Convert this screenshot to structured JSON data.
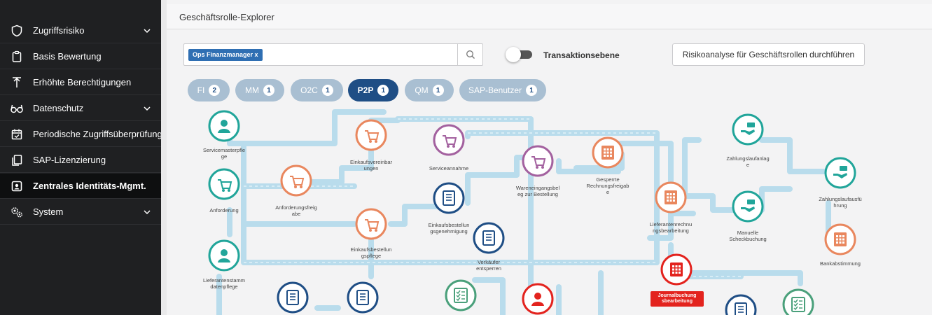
{
  "sidebar": {
    "items": [
      {
        "label": "Zugriffsrisiko",
        "icon": "shield-icon",
        "expandable": true
      },
      {
        "label": "Basis Bewertung",
        "icon": "clipboard-icon",
        "expandable": false
      },
      {
        "label": "Erhöhte Berechtigungen",
        "icon": "elevate-icon",
        "expandable": false
      },
      {
        "label": "Datenschutz",
        "icon": "glasses-icon",
        "expandable": true
      },
      {
        "label": "Periodische Zugriffsüberprüfung",
        "icon": "calendar-check-icon",
        "expandable": false
      },
      {
        "label": "SAP-Lizenzierung",
        "icon": "license-icon",
        "expandable": false
      },
      {
        "label": "Zentrales Identitäts-Mgmt.",
        "icon": "id-card-icon",
        "expandable": false,
        "active": true
      },
      {
        "label": "System",
        "icon": "gears-icon",
        "expandable": true
      }
    ]
  },
  "header": {
    "title": "Geschäftsrolle-Explorer"
  },
  "search": {
    "chip": "Ops Finanzmanager  x"
  },
  "toggle": {
    "label": "Transaktionsebene",
    "on": false
  },
  "risk_button": {
    "label": "Risikoanalyse für Geschäftsrollen durchführen"
  },
  "tabs": [
    {
      "label": "FI",
      "count": "2",
      "active": false
    },
    {
      "label": "MM",
      "count": "1",
      "active": false
    },
    {
      "label": "O2C",
      "count": "1",
      "active": false
    },
    {
      "label": "P2P",
      "count": "1",
      "active": true
    },
    {
      "label": "QM",
      "count": "1",
      "active": false
    },
    {
      "label": "SAP-Benutzer",
      "count": "1",
      "active": false
    }
  ],
  "colors": {
    "teal": "#21a59a",
    "orange": "#e9875e",
    "purple": "#a3619f",
    "navy": "#1f4e85",
    "green": "#4aa07b",
    "red": "#e3231e",
    "pipe": "#b9dcec"
  },
  "nodes": [
    {
      "id": "servicemasterpflege",
      "label": "Servicemasterpfle\nge",
      "color": "teal",
      "icon": "user-icon"
    },
    {
      "id": "anforderung",
      "label": "Anforderung",
      "color": "teal",
      "icon": "cart-icon"
    },
    {
      "id": "lieferantenstamm",
      "label": "Lieferantenstamm\ndatenpflege",
      "color": "teal",
      "icon": "user-icon"
    },
    {
      "id": "anforderungsfreigabe",
      "label": "Anforderungsfreig\nabe",
      "color": "orange",
      "icon": "cart-icon"
    },
    {
      "id": "einkaufsvereinbarungen",
      "label": "Einkaufsvereinbar\nungen",
      "color": "orange",
      "icon": "cart-icon"
    },
    {
      "id": "einkaufsbestellungspflege",
      "label": "Einkaufsbestellun\ngspflege",
      "color": "orange",
      "icon": "cart-icon"
    },
    {
      "id": "serviceannahme",
      "label": "Serviceannahme",
      "color": "purple",
      "icon": "trolley-icon"
    },
    {
      "id": "einkaufsbestellungsgenehmigung",
      "label": "Einkaufsbestellun\ngsgenehmigung",
      "color": "navy",
      "icon": "document-icon"
    },
    {
      "id": "verkaeufer",
      "label": "Verkäufer\nentsperren",
      "color": "navy",
      "icon": "document-icon"
    },
    {
      "id": "wareneingang",
      "label": "Wareneingangsbel\neg zur Bestellung",
      "color": "purple",
      "icon": "trolley-icon"
    },
    {
      "id": "gesperrte",
      "label": "Gesperrte\nRechnungsfreigab\ne",
      "color": "orange",
      "icon": "invoice-icon"
    },
    {
      "id": "lieferantenrechnung",
      "label": "Lieferantenrechnu\nngsbearbeitung",
      "color": "orange",
      "icon": "invoice-icon"
    },
    {
      "id": "zahlungslaufanlage",
      "label": "Zahlungslaufanlag\ne",
      "color": "teal",
      "icon": "payment-icon"
    },
    {
      "id": "manuelle",
      "label": "Manuelle\nScheckbuchung",
      "color": "teal",
      "icon": "payment-icon"
    },
    {
      "id": "zahlungslaufausfuehrung",
      "label": "Zahlungslaufausfü\nhrung",
      "color": "teal",
      "icon": "payment-icon"
    },
    {
      "id": "bankabstimmung",
      "label": "Bankabstimmung",
      "color": "orange",
      "icon": "invoice-icon"
    }
  ],
  "highlight_node": {
    "label": "Journalbuchung\nsbearbeitung"
  }
}
